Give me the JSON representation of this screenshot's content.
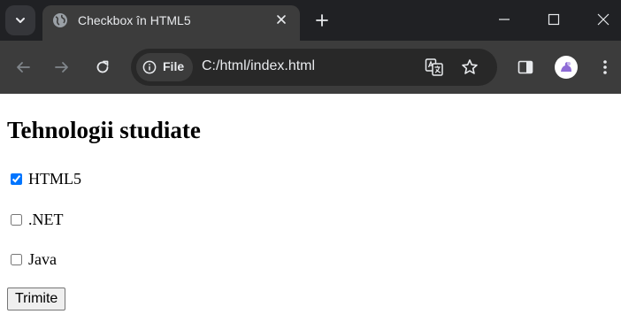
{
  "browser": {
    "tab": {
      "title": "Checkbox în HTML5",
      "favicon": "globe-icon"
    },
    "omnibox": {
      "site_chip_label": "File",
      "url": "C:/html/index.html"
    },
    "colors": {
      "titlebar": "#202124",
      "toolbar": "#3c3c3c",
      "omnibox": "#282828",
      "icon": "#e8eaed"
    }
  },
  "page": {
    "title": "Tehnologii studiate",
    "options": [
      {
        "label": "HTML5",
        "checked": true
      },
      {
        "label": ".NET",
        "checked": false
      },
      {
        "label": "Java",
        "checked": false
      }
    ],
    "submit_label": "Trimite"
  }
}
